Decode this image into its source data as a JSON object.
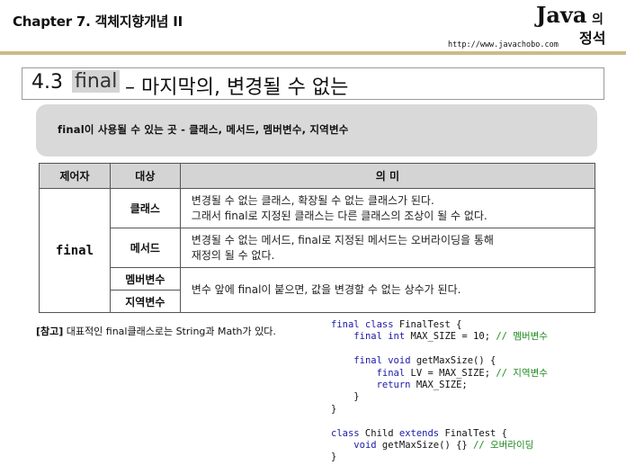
{
  "header": {
    "chapter_title": "Chapter 7. 객체지향개념 II",
    "logo_java": "Java",
    "logo_ui": "의",
    "logo_jeongseok": "정석",
    "url": "http://www.javachobo.com"
  },
  "section": {
    "number": "4.3",
    "keyword": "final",
    "rest": "– 마지막의, 변경될 수 없는"
  },
  "summary": "final이 사용될 수 있는 곳 - 클래스, 메서드, 멤버변수, 지역변수",
  "table": {
    "headers": [
      "제어자",
      "대상",
      "의 미"
    ],
    "modifier": "final",
    "rows": [
      {
        "target": "클래스",
        "desc1": "변경될 수 없는 클래스, 확장될 수 없는 클래스가 된다.",
        "desc2": "그래서 final로 지정된 클래스는 다른 클래스의 조상이 될 수 없다."
      },
      {
        "target": "메서드",
        "desc1": "변경될 수 없는 메서드, final로 지정된 메서드는 오버라이딩을 통해",
        "desc2": "재정의 될 수 없다."
      },
      {
        "target": "멤버변수",
        "desc1": "변수 앞에 final이 붙으면, 값을 변경할 수 없는 상수가 된다."
      },
      {
        "target": "지역변수"
      }
    ]
  },
  "note": {
    "label": "[참고]",
    "text": "대표적인 final클래스로는 String과 Math가 있다."
  },
  "code": {
    "l1_kw": "final class",
    "l1_rest": " FinalTest {",
    "l2_kw": "final int",
    "l2_rest": " MAX_SIZE = 10; ",
    "l2_cm": "// 멤버변수",
    "l3_kw": "final void",
    "l3_rest": " getMaxSize() {",
    "l4_kw": "final",
    "l4_rest": " LV = MAX_SIZE; ",
    "l4_cm": "// 지역변수",
    "l5_kw": "return",
    "l5_rest": " MAX_SIZE;",
    "l6": "}",
    "l7": "}",
    "l8_kw1": "class",
    "l8_mid": " Child ",
    "l8_kw2": "extends",
    "l8_rest": " FinalTest {",
    "l9_kw": "void",
    "l9_rest": " getMaxSize() {} ",
    "l9_cm": "// 오버라이딩",
    "l10": "}"
  }
}
